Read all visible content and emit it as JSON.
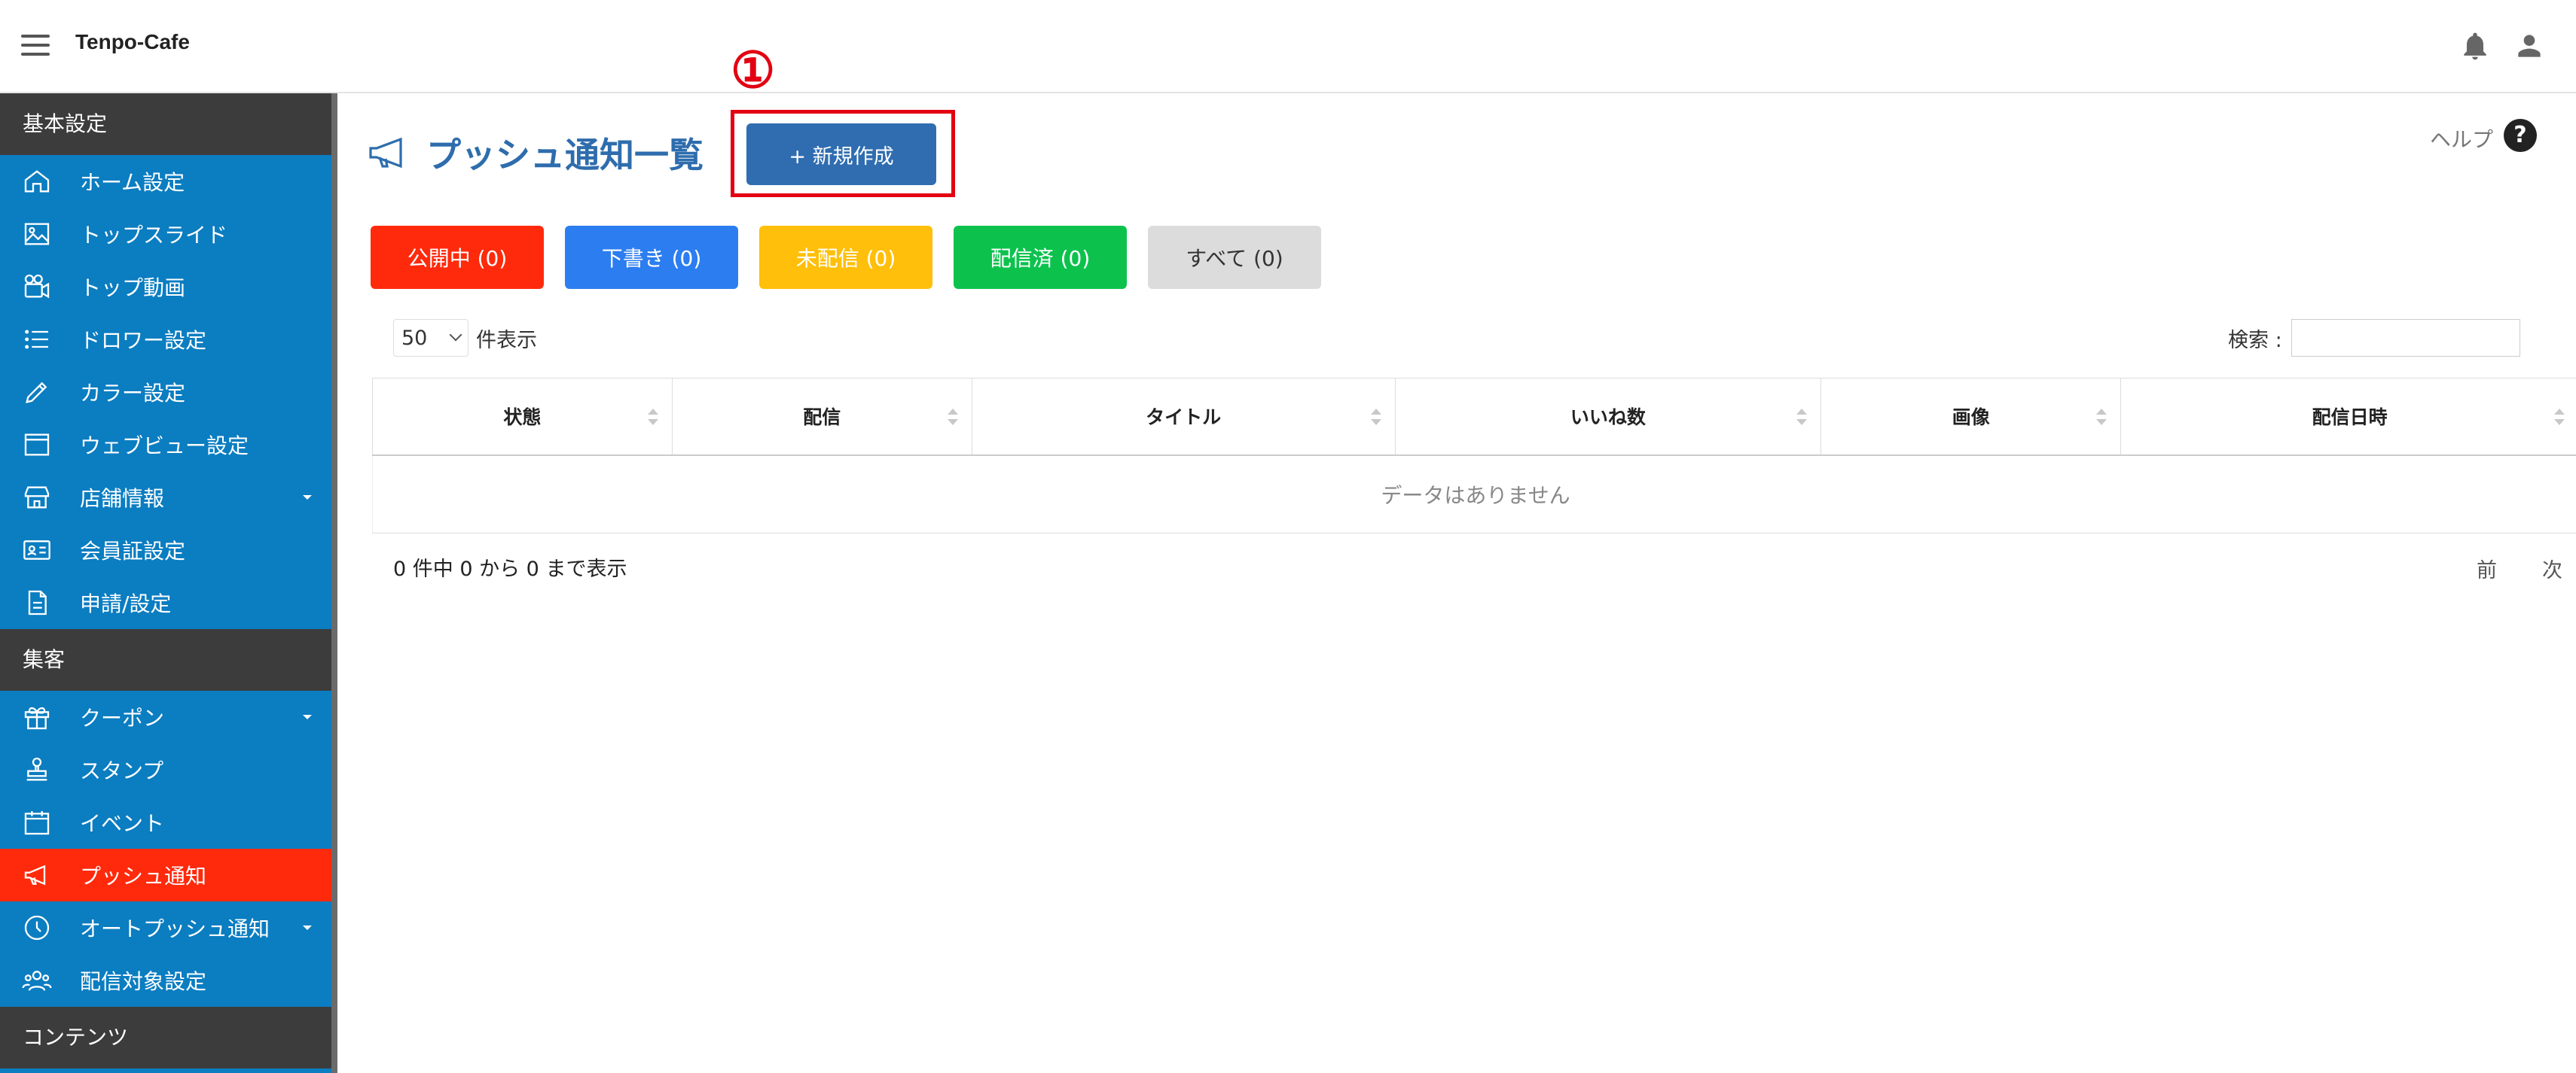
{
  "app": {
    "title": "Tenpo-Cafe"
  },
  "header": {
    "bell_icon": "bell-icon",
    "user_icon": "user-icon"
  },
  "sidebar": {
    "sections": [
      {
        "title": "基本設定",
        "items": [
          {
            "label": "ホーム設定",
            "icon": "home-icon"
          },
          {
            "label": "トップスライド",
            "icon": "image-icon"
          },
          {
            "label": "トップ動画",
            "icon": "video-camera-icon"
          },
          {
            "label": "ドロワー設定",
            "icon": "list-icon"
          },
          {
            "label": "カラー設定",
            "icon": "pencil-icon"
          },
          {
            "label": "ウェブビュー設定",
            "icon": "browser-window-icon"
          },
          {
            "label": "店舗情報",
            "icon": "store-icon",
            "has_submenu": true
          },
          {
            "label": "会員証設定",
            "icon": "id-card-icon"
          },
          {
            "label": "申請/設定",
            "icon": "document-icon"
          }
        ]
      },
      {
        "title": "集客",
        "items": [
          {
            "label": "クーポン",
            "icon": "gift-icon",
            "has_submenu": true
          },
          {
            "label": "スタンプ",
            "icon": "stamp-icon"
          },
          {
            "label": "イベント",
            "icon": "calendar-icon"
          },
          {
            "label": "プッシュ通知",
            "icon": "megaphone-icon",
            "active": true
          },
          {
            "label": "オートプッシュ通知",
            "icon": "clock-icon",
            "has_submenu": true
          },
          {
            "label": "配信対象設定",
            "icon": "users-icon"
          }
        ]
      },
      {
        "title": "コンテンツ",
        "items": []
      }
    ]
  },
  "main": {
    "title": "プッシュ通知一覧",
    "new_button": "+ 新規作成",
    "step_marker": "①",
    "help_label": "ヘルプ",
    "help_icon": "?",
    "filters": [
      {
        "label": "公開中 (0)",
        "color": "#ff2a0c"
      },
      {
        "label": "下書き (0)",
        "color": "#2c7df0"
      },
      {
        "label": "未配信 (0)",
        "color": "#ffbf0a"
      },
      {
        "label": "配信済 (0)",
        "color": "#0cc24d"
      },
      {
        "label": "すべて (0)",
        "color": "#dcdcdc",
        "text_color": "#333"
      }
    ],
    "length": {
      "value": "50",
      "suffix": "件表示"
    },
    "search": {
      "label": "検索 :",
      "value": ""
    },
    "table": {
      "columns": [
        "状態",
        "配信",
        "タイトル",
        "いいね数",
        "画像",
        "配信日時"
      ],
      "empty_message": "データはありません"
    },
    "info": "0 件中 0 から 0 まで表示",
    "pager": {
      "prev": "前",
      "next": "次"
    }
  }
}
